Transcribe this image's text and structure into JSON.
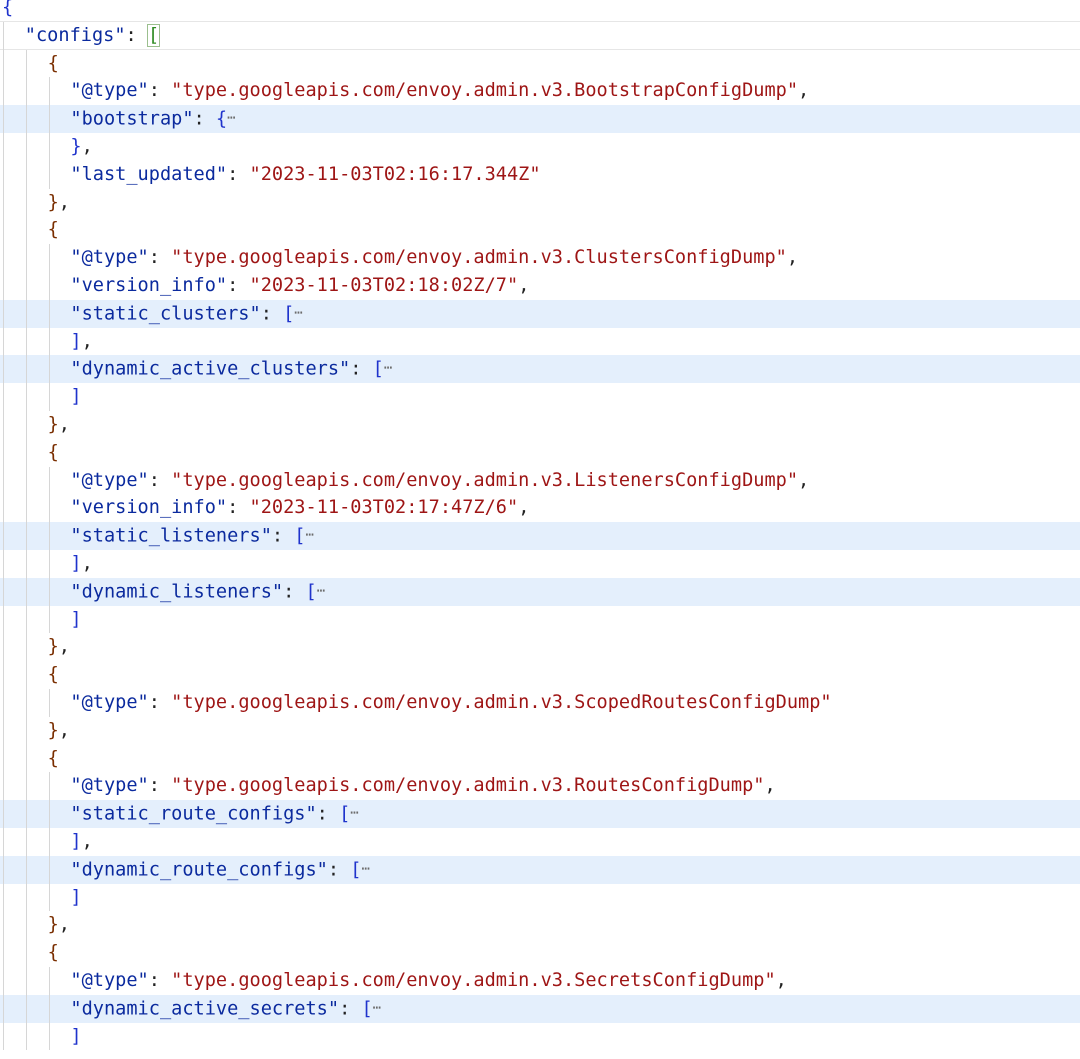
{
  "editor": {
    "ellipsis": "⋯",
    "lines": [
      {
        "kind": "open",
        "depth": 0,
        "bracket": "{",
        "bcls": "br0"
      },
      {
        "kind": "keyopen",
        "depth": 1,
        "key": "\"configs\"",
        "bracket": "[",
        "bcls": "br1",
        "boxed": true
      },
      {
        "kind": "open",
        "depth": 2,
        "bracket": "{",
        "bcls": "br2"
      },
      {
        "kind": "kv",
        "depth": 3,
        "key": "\"@type\"",
        "value": "\"type.googleapis.com/envoy.admin.v3.BootstrapConfigDump\"",
        "comma": true
      },
      {
        "kind": "folded",
        "depth": 3,
        "key": "\"bootstrap\"",
        "bracket": "{",
        "bcls": "br3",
        "hl": true
      },
      {
        "kind": "close",
        "depth": 3,
        "bracket": "}",
        "bcls": "br3",
        "comma": true
      },
      {
        "kind": "kv",
        "depth": 3,
        "key": "\"last_updated\"",
        "value": "\"2023-11-03T02:16:17.344Z\"",
        "comma": false
      },
      {
        "kind": "close",
        "depth": 2,
        "bracket": "}",
        "bcls": "br2",
        "comma": true
      },
      {
        "kind": "open",
        "depth": 2,
        "bracket": "{",
        "bcls": "br2"
      },
      {
        "kind": "kv",
        "depth": 3,
        "key": "\"@type\"",
        "value": "\"type.googleapis.com/envoy.admin.v3.ClustersConfigDump\"",
        "comma": true
      },
      {
        "kind": "kv",
        "depth": 3,
        "key": "\"version_info\"",
        "value": "\"2023-11-03T02:18:02Z/7\"",
        "comma": true
      },
      {
        "kind": "folded",
        "depth": 3,
        "key": "\"static_clusters\"",
        "bracket": "[",
        "bcls": "br3",
        "hl": true
      },
      {
        "kind": "close",
        "depth": 3,
        "bracket": "]",
        "bcls": "br3",
        "comma": true
      },
      {
        "kind": "folded",
        "depth": 3,
        "key": "\"dynamic_active_clusters\"",
        "bracket": "[",
        "bcls": "br3",
        "hl": true
      },
      {
        "kind": "close",
        "depth": 3,
        "bracket": "]",
        "bcls": "br3",
        "comma": false
      },
      {
        "kind": "close",
        "depth": 2,
        "bracket": "}",
        "bcls": "br2",
        "comma": true
      },
      {
        "kind": "open",
        "depth": 2,
        "bracket": "{",
        "bcls": "br2"
      },
      {
        "kind": "kv",
        "depth": 3,
        "key": "\"@type\"",
        "value": "\"type.googleapis.com/envoy.admin.v3.ListenersConfigDump\"",
        "comma": true
      },
      {
        "kind": "kv",
        "depth": 3,
        "key": "\"version_info\"",
        "value": "\"2023-11-03T02:17:47Z/6\"",
        "comma": true
      },
      {
        "kind": "folded",
        "depth": 3,
        "key": "\"static_listeners\"",
        "bracket": "[",
        "bcls": "br3",
        "hl": true
      },
      {
        "kind": "close",
        "depth": 3,
        "bracket": "]",
        "bcls": "br3",
        "comma": true
      },
      {
        "kind": "folded",
        "depth": 3,
        "key": "\"dynamic_listeners\"",
        "bracket": "[",
        "bcls": "br3",
        "hl": true
      },
      {
        "kind": "close",
        "depth": 3,
        "bracket": "]",
        "bcls": "br3",
        "comma": false
      },
      {
        "kind": "close",
        "depth": 2,
        "bracket": "}",
        "bcls": "br2",
        "comma": true
      },
      {
        "kind": "open",
        "depth": 2,
        "bracket": "{",
        "bcls": "br2"
      },
      {
        "kind": "kv",
        "depth": 3,
        "key": "\"@type\"",
        "value": "\"type.googleapis.com/envoy.admin.v3.ScopedRoutesConfigDump\"",
        "comma": false
      },
      {
        "kind": "close",
        "depth": 2,
        "bracket": "}",
        "bcls": "br2",
        "comma": true
      },
      {
        "kind": "open",
        "depth": 2,
        "bracket": "{",
        "bcls": "br2"
      },
      {
        "kind": "kv",
        "depth": 3,
        "key": "\"@type\"",
        "value": "\"type.googleapis.com/envoy.admin.v3.RoutesConfigDump\"",
        "comma": true
      },
      {
        "kind": "folded",
        "depth": 3,
        "key": "\"static_route_configs\"",
        "bracket": "[",
        "bcls": "br3",
        "hl": true
      },
      {
        "kind": "close",
        "depth": 3,
        "bracket": "]",
        "bcls": "br3",
        "comma": true
      },
      {
        "kind": "folded",
        "depth": 3,
        "key": "\"dynamic_route_configs\"",
        "bracket": "[",
        "bcls": "br3",
        "hl": true
      },
      {
        "kind": "close",
        "depth": 3,
        "bracket": "]",
        "bcls": "br3",
        "comma": false
      },
      {
        "kind": "close",
        "depth": 2,
        "bracket": "}",
        "bcls": "br2",
        "comma": true
      },
      {
        "kind": "open",
        "depth": 2,
        "bracket": "{",
        "bcls": "br2"
      },
      {
        "kind": "kv",
        "depth": 3,
        "key": "\"@type\"",
        "value": "\"type.googleapis.com/envoy.admin.v3.SecretsConfigDump\"",
        "comma": true
      },
      {
        "kind": "folded",
        "depth": 3,
        "key": "\"dynamic_active_secrets\"",
        "bracket": "[",
        "bcls": "br3",
        "hl": true
      },
      {
        "kind": "close",
        "depth": 3,
        "bracket": "]",
        "bcls": "br3",
        "comma": false
      }
    ]
  }
}
